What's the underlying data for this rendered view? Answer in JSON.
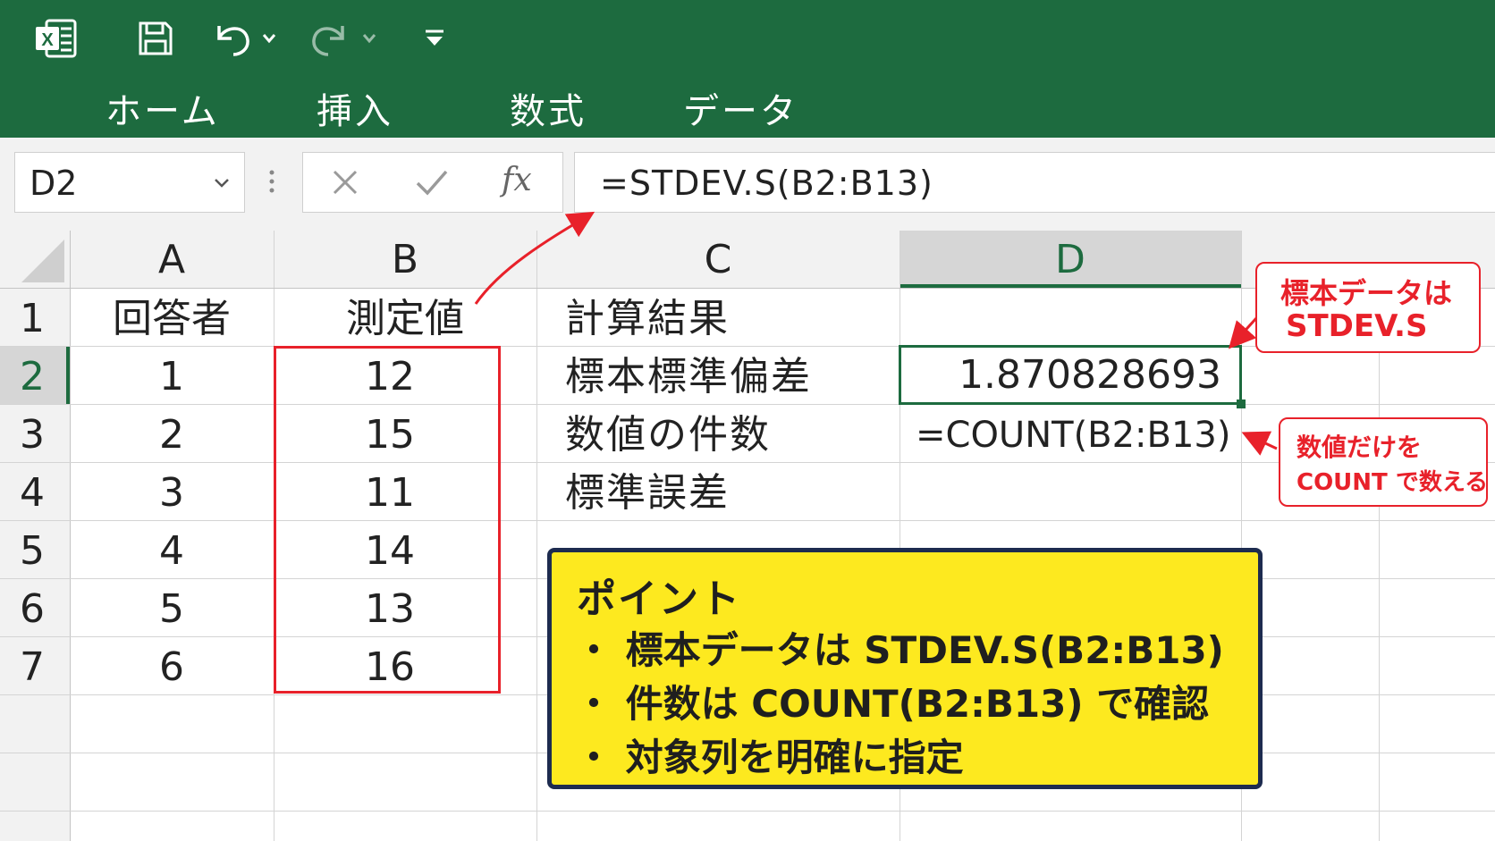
{
  "app": {
    "logo_letter": "X"
  },
  "ribbon": {
    "tabs": [
      {
        "label": "ホーム",
        "active": true
      },
      {
        "label": "挿入",
        "active": false
      },
      {
        "label": "数式",
        "active": false
      },
      {
        "label": "データ",
        "active": false
      }
    ],
    "quick_access": [
      "excel-logo-icon",
      "save-icon",
      "undo-icon",
      "redo-icon",
      "customize-icon"
    ]
  },
  "formula_bar": {
    "name_box": "D2",
    "fx_label": "fx",
    "formula": "=STDEV.S(B2:B13)"
  },
  "sheet": {
    "columns": [
      "A",
      "B",
      "C",
      "D"
    ],
    "selected_column": "D",
    "selected_cell": "D2",
    "rows": [
      {
        "num": "1",
        "a": "回答者",
        "b": "測定値",
        "c": "計算結果",
        "d": ""
      },
      {
        "num": "2",
        "a": "1",
        "b": "12",
        "c": "標本標準偏差",
        "d": "1.870828693"
      },
      {
        "num": "3",
        "a": "2",
        "b": "15",
        "c": "数値の件数",
        "d": "=COUNT(B2:B13)"
      },
      {
        "num": "4",
        "a": "3",
        "b": "11",
        "c": "標準誤差",
        "d": ""
      },
      {
        "num": "5",
        "a": "4",
        "b": "14",
        "c": "",
        "d": ""
      },
      {
        "num": "6",
        "a": "5",
        "b": "13",
        "c": "",
        "d": ""
      },
      {
        "num": "7",
        "a": "6",
        "b": "16",
        "c": "",
        "d": ""
      }
    ]
  },
  "annotations": {
    "callout1": {
      "line1": "標本データは",
      "line2": "STDEV.S"
    },
    "callout2": {
      "line1": "数値だけを",
      "line2": "COUNT で数える"
    },
    "point": {
      "title": "ポイント",
      "items": [
        "・ 標本データは STDEV.S(B2:B13)",
        "・ 件数は COUNT(B2:B13) で確認",
        "・ 対象列を明確に指定"
      ]
    }
  },
  "colors": {
    "ribbon": "#1d6b3f",
    "accent_green": "#1d6b3f",
    "annotation_red": "#e8212a",
    "point_yellow": "#fde91f",
    "point_border": "#1d2b4f"
  }
}
